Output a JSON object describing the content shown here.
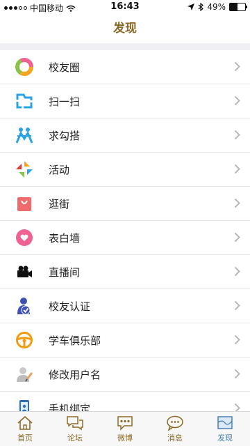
{
  "status": {
    "carrier": "中国移动",
    "time": "16:43",
    "battery": "49%",
    "battery_level": 0.49
  },
  "header": {
    "title": "发现"
  },
  "menu": [
    {
      "label": "校友圈"
    },
    {
      "label": "扫一扫"
    },
    {
      "label": "求勾搭"
    },
    {
      "label": "活动"
    },
    {
      "label": "逛街"
    },
    {
      "label": "表白墙"
    },
    {
      "label": "直播间"
    },
    {
      "label": "校友认证"
    },
    {
      "label": "学车俱乐部"
    },
    {
      "label": "修改用户名"
    },
    {
      "label": "手机绑定"
    }
  ],
  "tabs": [
    {
      "label": "首页"
    },
    {
      "label": "论坛"
    },
    {
      "label": "微博"
    },
    {
      "label": "消息"
    },
    {
      "label": "发现",
      "active": true
    }
  ],
  "colors": {
    "accent": "#8b6a27",
    "active_tab": "#4a7fb8"
  }
}
